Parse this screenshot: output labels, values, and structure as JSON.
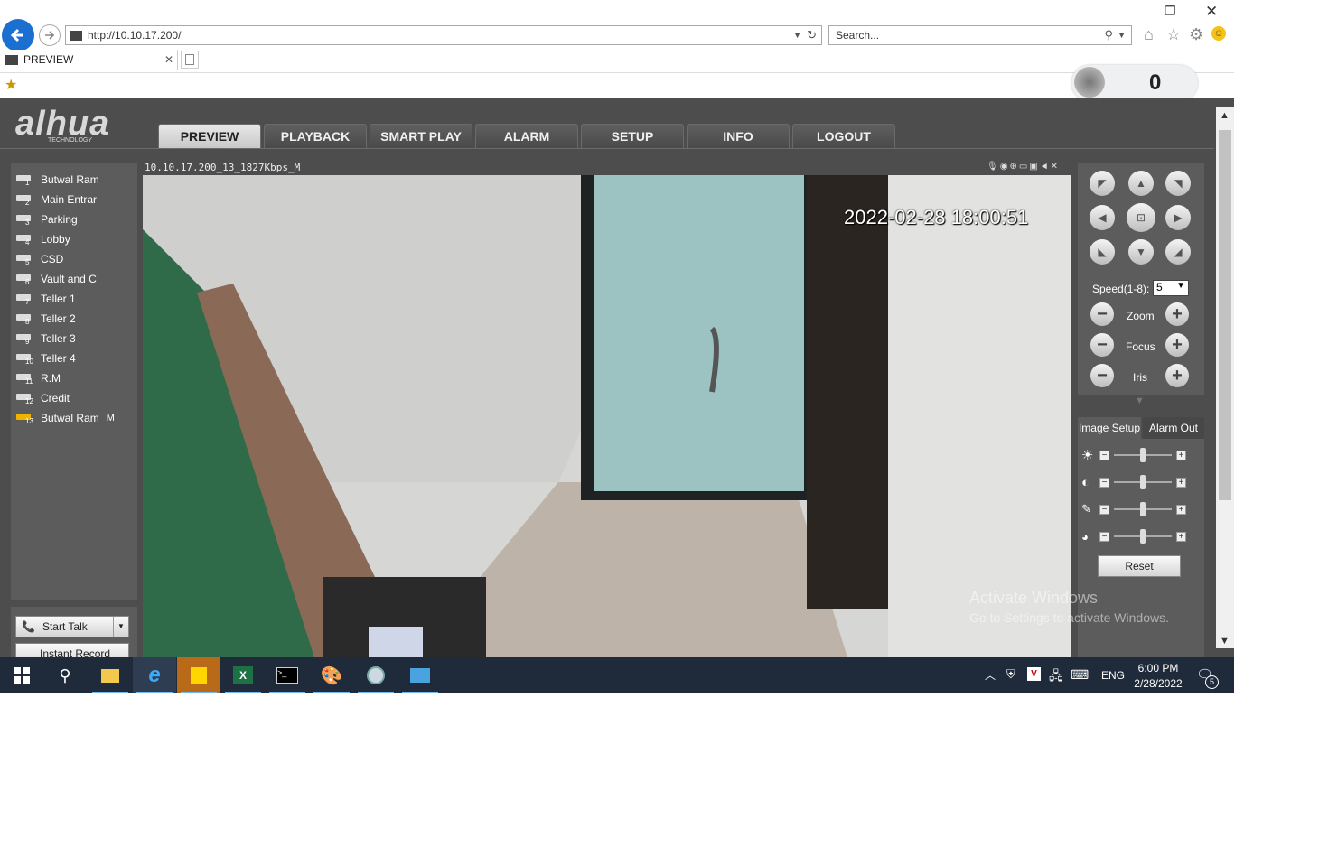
{
  "browser": {
    "url": "http://10.10.17.200/",
    "search_placeholder": "Search...",
    "tab_title": "PREVIEW",
    "badge_count": "0"
  },
  "app": {
    "brand": "alhua",
    "brand_sub": "TECHNOLOGY",
    "nav": [
      "PREVIEW",
      "PLAYBACK",
      "SMART PLAY",
      "ALARM",
      "SETUP",
      "INFO",
      "LOGOUT"
    ],
    "cameras": [
      {
        "num": "1",
        "label": "Butwal Ram"
      },
      {
        "num": "2",
        "label": "Main Entrar"
      },
      {
        "num": "3",
        "label": "Parking"
      },
      {
        "num": "4",
        "label": "Lobby"
      },
      {
        "num": "5",
        "label": "CSD"
      },
      {
        "num": "6",
        "label": "Vault and C"
      },
      {
        "num": "7",
        "label": "Teller 1"
      },
      {
        "num": "8",
        "label": "Teller 2"
      },
      {
        "num": "9",
        "label": "Teller 3"
      },
      {
        "num": "10",
        "label": "Teller 4"
      },
      {
        "num": "11",
        "label": "R.M"
      },
      {
        "num": "12",
        "label": "Credit"
      },
      {
        "num": "13",
        "label": "Butwal Ram",
        "suffix": "M"
      }
    ],
    "start_talk": "Start Talk",
    "instant_record": "Instant Record",
    "video_title": "10.10.17.200_13_1827Kbps_M",
    "video_timestamp": "2022-02-28 18:00:51",
    "speed_label": "Speed(1-8):",
    "speed_value": "5",
    "zoom_label": "Zoom",
    "focus_label": "Focus",
    "iris_label": "Iris",
    "tabs": [
      "Image Setup",
      "Alarm Out"
    ],
    "reset_label": "Reset",
    "watermark_title": "Activate Windows",
    "watermark_sub": "Go to Settings to activate Windows."
  },
  "taskbar": {
    "lang": "ENG",
    "time": "6:00 PM",
    "date": "2/28/2022",
    "notifications": "5"
  }
}
